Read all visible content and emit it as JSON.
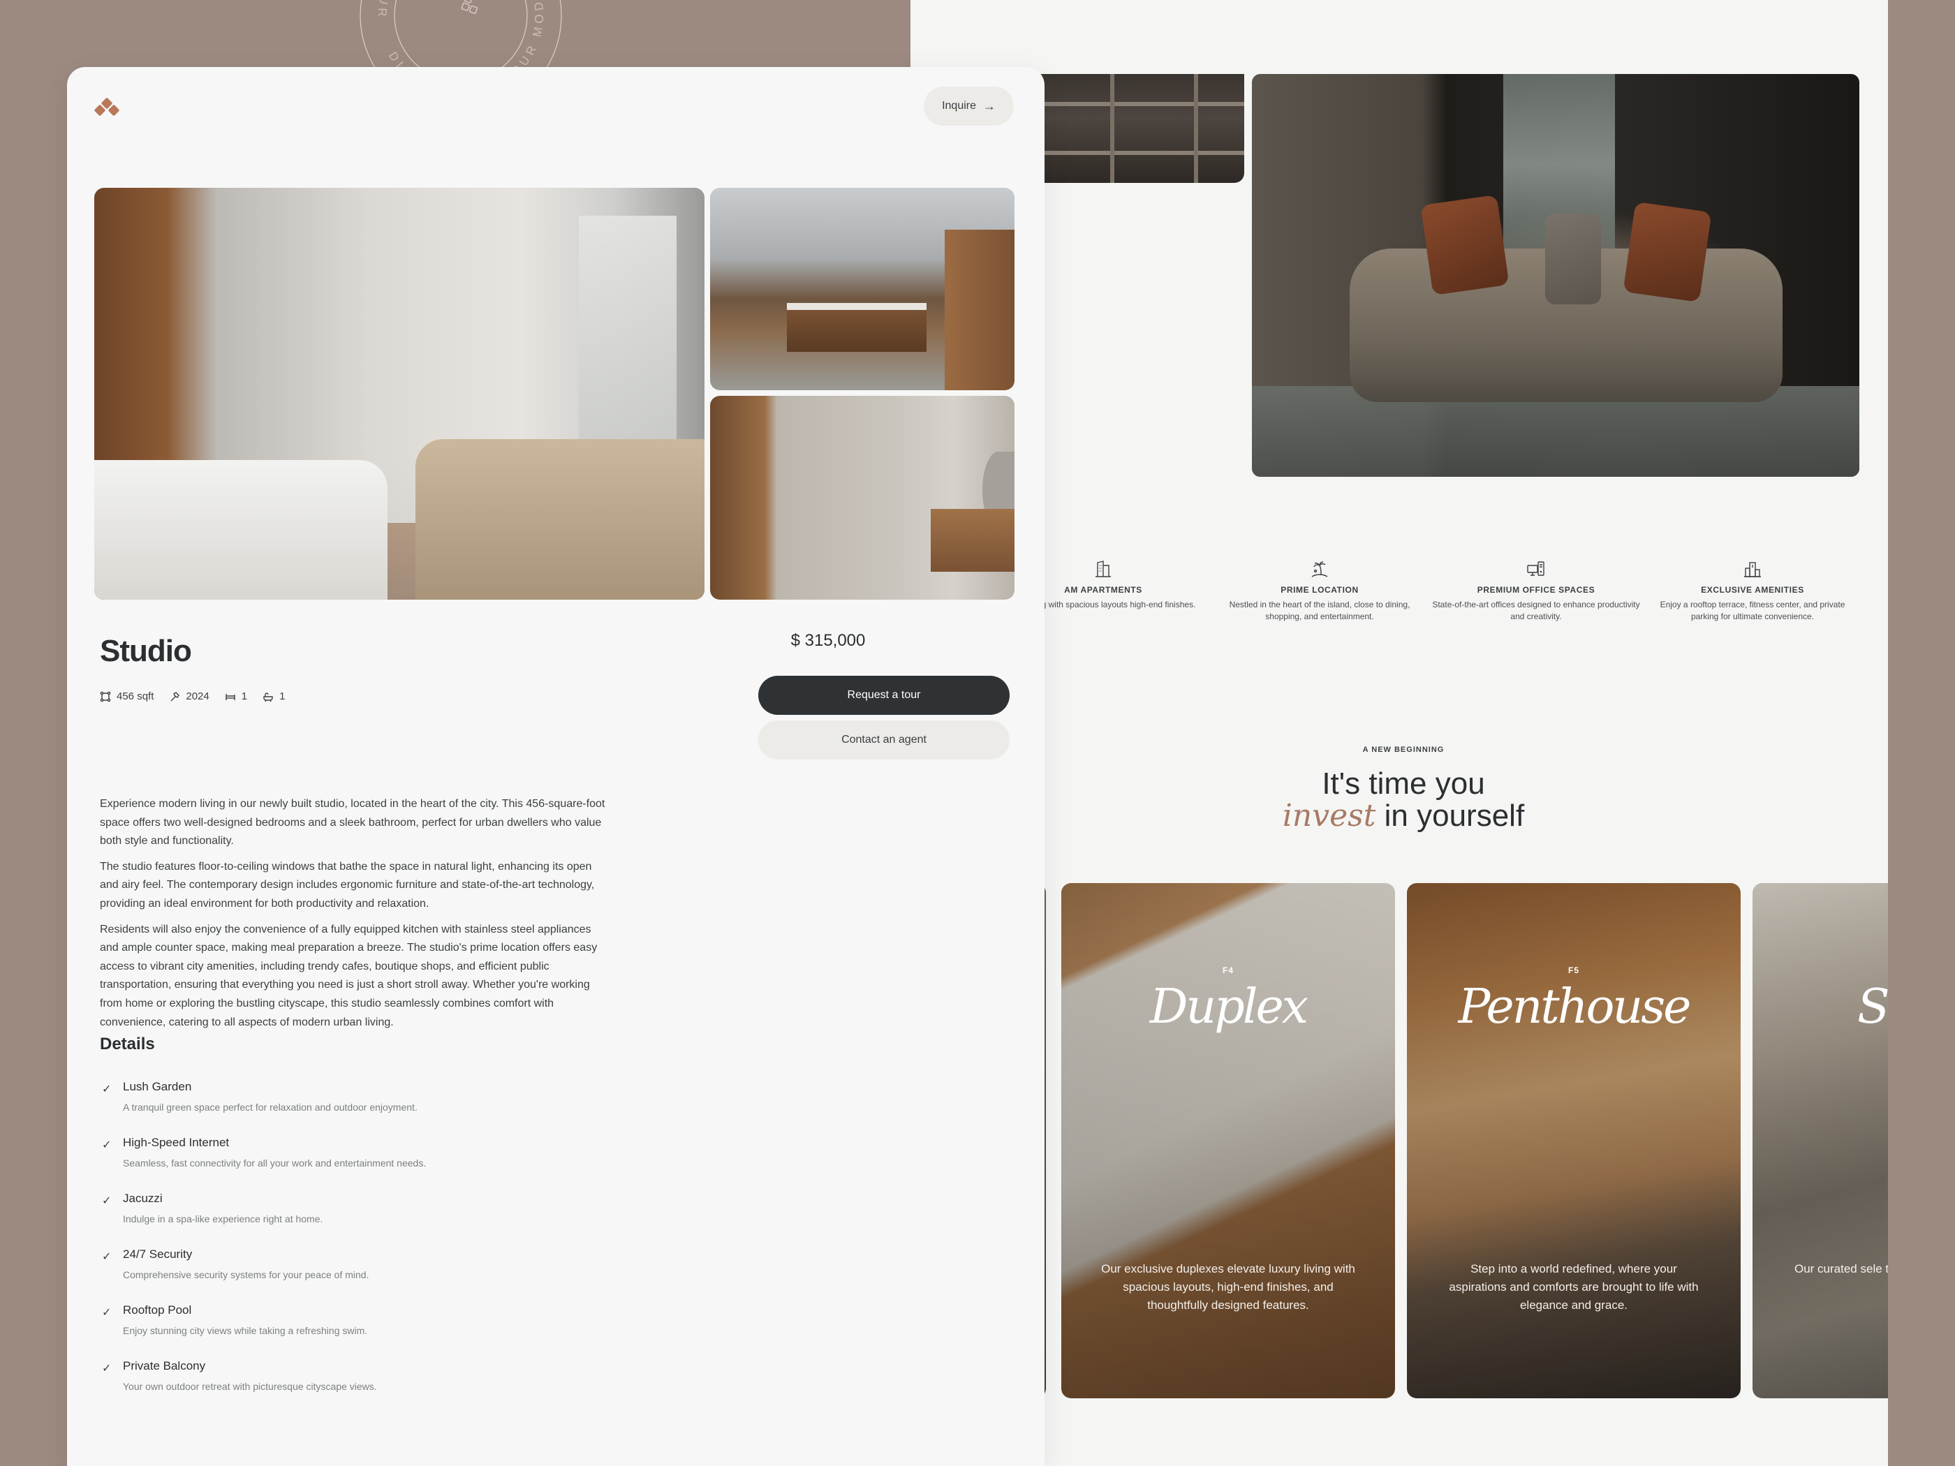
{
  "badge": {
    "ring_text": "DISCOVERING YOUR MODULA • DISCOVERING YOUR MODULA •"
  },
  "header": {
    "logo_icon": "diamond-cluster-logo",
    "inquire_label": "Inquire",
    "inquire_icon": "arrow-right-icon"
  },
  "listing": {
    "title": "Studio",
    "price": "$ 315,000",
    "meta": [
      {
        "icon": "area-icon",
        "value": "456 sqft"
      },
      {
        "icon": "hammer-icon",
        "value": "2024"
      },
      {
        "icon": "bed-icon",
        "value": "1"
      },
      {
        "icon": "bath-icon",
        "value": "1"
      }
    ],
    "description": [
      "Experience modern living in our newly built studio, located in the heart of the city. This 456-square-foot space offers two well-designed bedrooms and a sleek bathroom, perfect for urban dwellers who value both style and functionality.",
      "The studio features floor-to-ceiling windows that bathe the space in natural light, enhancing its open and airy feel. The contemporary design includes ergonomic furniture and state-of-the-art technology, providing an ideal environment for both productivity and relaxation.",
      "Residents will also enjoy the convenience of a fully equipped kitchen with stainless steel appliances and ample counter space, making meal preparation a breeze. The studio's prime location offers easy access to vibrant city amenities, including trendy cafes, boutique shops, and efficient public transportation, ensuring that everything you need is just a short stroll away. Whether you're working from home or exploring the bustling cityscape, this studio seamlessly combines comfort with convenience, catering to all aspects of modern urban living."
    ],
    "request_tour_label": "Request a tour",
    "contact_agent_label": "Contact an agent",
    "details_title": "Details",
    "details": [
      {
        "name": "Lush Garden",
        "desc": "A tranquil green space perfect for relaxation and outdoor enjoyment."
      },
      {
        "name": "High-Speed Internet",
        "desc": "Seamless, fast connectivity for all your work and entertainment needs."
      },
      {
        "name": "Jacuzzi",
        "desc": "Indulge in a spa-like experience right at home."
      },
      {
        "name": "24/7 Security",
        "desc": "Comprehensive security systems for your peace of mind."
      },
      {
        "name": "Rooftop Pool",
        "desc": "Enjoy stunning city views while taking a refreshing swim."
      },
      {
        "name": "Private Balcony",
        "desc": "Your own outdoor retreat with picturesque cityscape views."
      }
    ],
    "check_glyph": "✓"
  },
  "features": [
    {
      "icon": "building-icon",
      "title": "AM APARTMENTS",
      "desc": "ned living with spacious layouts high-end finishes."
    },
    {
      "icon": "palm-island-icon",
      "title": "PRIME LOCATION",
      "desc": "Nestled in the heart of the island, close to dining, shopping, and entertainment."
    },
    {
      "icon": "computer-icon",
      "title": "PREMIUM OFFICE SPACES",
      "desc": "State-of-the-art offices designed to enhance productivity and creativity."
    },
    {
      "icon": "podium-icon",
      "title": "EXCLUSIVE AMENITIES",
      "desc": "Enjoy a rooftop terrace, fitness center, and private parking for ultimate convenience."
    }
  ],
  "new_beginning": {
    "eyebrow": "A NEW BEGINNING",
    "line1": "It's time you",
    "accent": "invest",
    "line2_rest": " in yourself"
  },
  "cards": [
    {
      "label": "F4",
      "title": "Duplex",
      "desc": "Our exclusive duplexes elevate luxury living with spacious layouts, high-end finishes, and thoughtfully designed features."
    },
    {
      "label": "F5",
      "title": "Penthouse",
      "desc": "Step into a world redefined, where your aspirations and comforts are brought to life with elegance and grace."
    },
    {
      "label": "",
      "title": "St",
      "desc": "Our curated sele to find that sp working, an"
    }
  ],
  "colors": {
    "accent": "#b9785a",
    "accent_text": "#a77a66",
    "dark_button": "#2e3234",
    "light_button": "#ecebe8",
    "page_bg": "#9c8a80",
    "card_bg": "#f7f7f7"
  }
}
